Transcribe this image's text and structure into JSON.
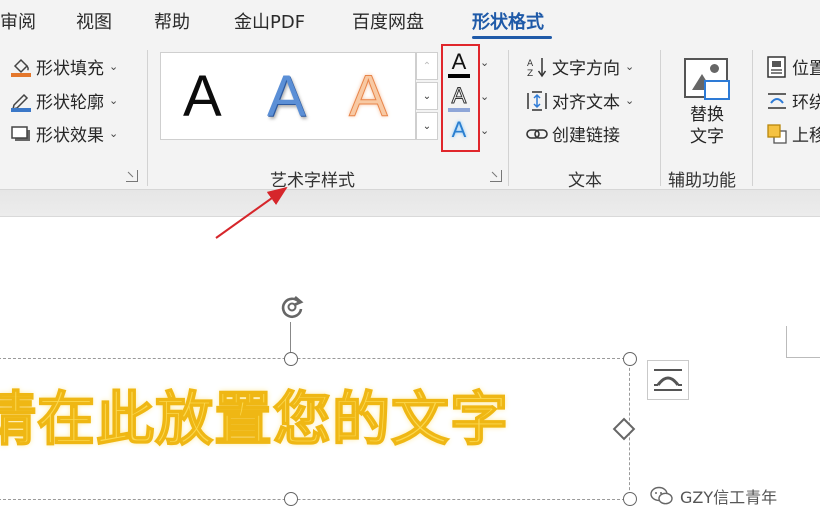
{
  "tabs": [
    {
      "label": "审阅",
      "active": false
    },
    {
      "label": "视图",
      "active": false
    },
    {
      "label": "帮助",
      "active": false
    },
    {
      "label": "金山PDF",
      "active": false
    },
    {
      "label": "百度网盘",
      "active": false
    },
    {
      "label": "形状格式",
      "active": true
    }
  ],
  "shape_styles": {
    "fill_label": "形状填充",
    "outline_label": "形状轮廓",
    "effect_label": "形状效果"
  },
  "wordart_styles": {
    "group_label": "艺术字样式",
    "gallery": [
      "A",
      "A",
      "A"
    ],
    "text_fill_glyph": "A",
    "text_outline_glyph": "A",
    "text_effect_glyph": "A"
  },
  "text_group": {
    "group_label": "文本",
    "direction_label": "文字方向",
    "align_label": "对齐文本",
    "link_label": "创建链接"
  },
  "accessibility": {
    "group_label": "辅助功能",
    "alt_text_line1": "替换",
    "alt_text_line2": "文字"
  },
  "arrange": {
    "position_label": "位置",
    "wrap_label": "环绕",
    "forward_label": "上移"
  },
  "document": {
    "wordart_text": "请在此放置您的文字"
  },
  "watermark": "GZY信工青年",
  "colors": {
    "accent": "#1f5aa8",
    "highlight_box": "#e0262b",
    "wordart_fill": "#fbd850",
    "text_fill_bar": "#000000",
    "text_outline_bar": "#8fa6d8",
    "text_effect_color": "#2b7fd0"
  }
}
